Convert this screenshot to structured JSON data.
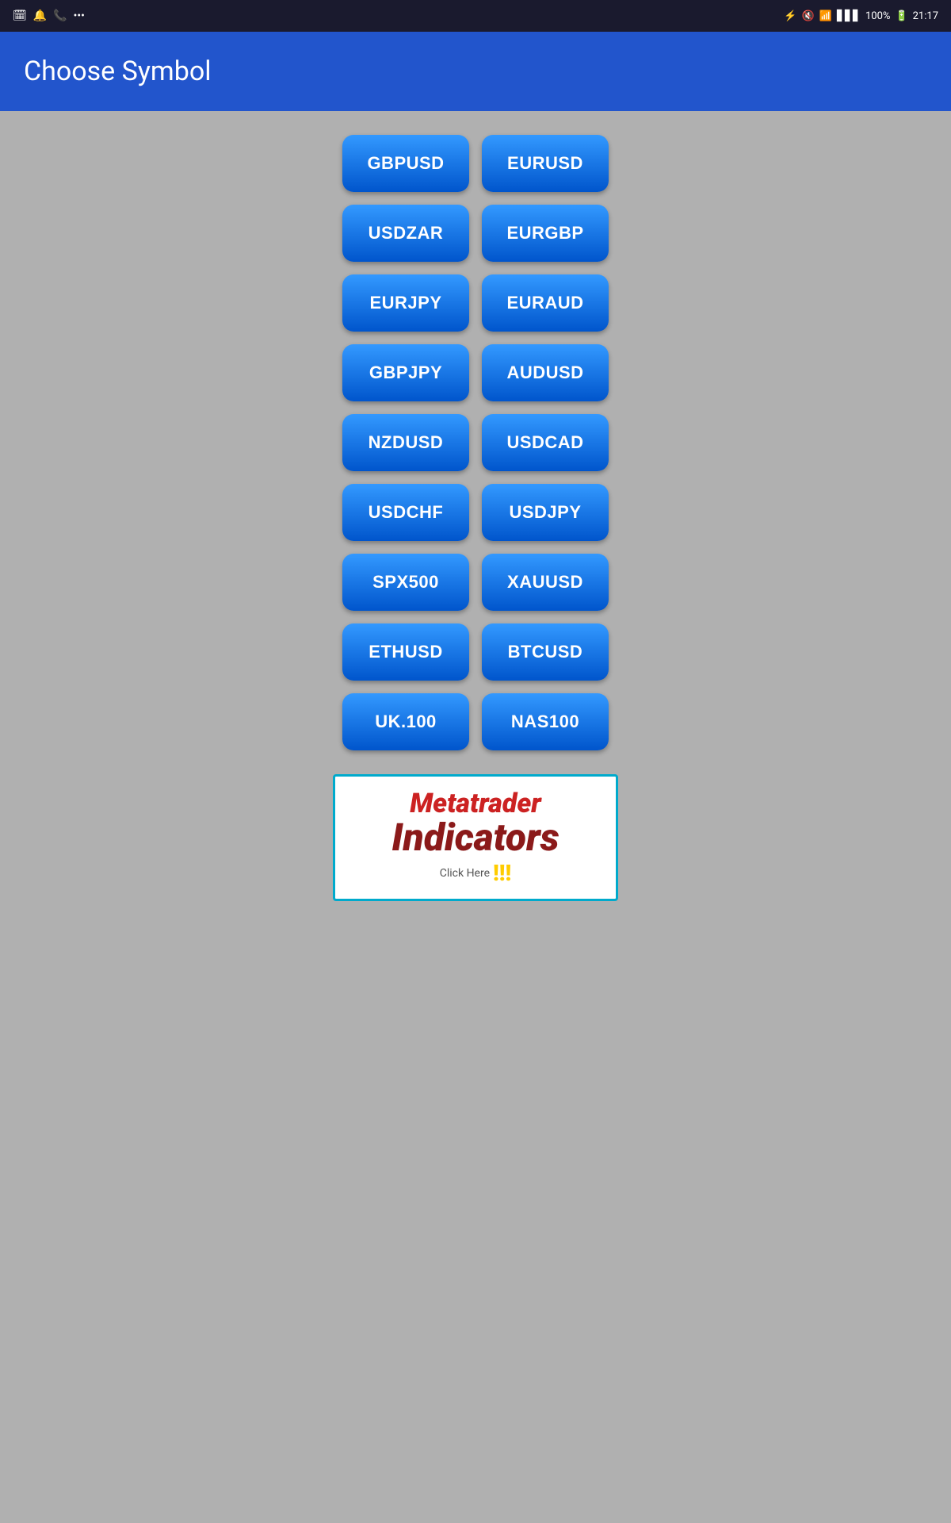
{
  "statusBar": {
    "leftIcons": [
      "bluetooth",
      "notification",
      "phone",
      "more"
    ],
    "rightIcons": [
      "bluetooth",
      "mute",
      "wifi",
      "signal"
    ],
    "battery": "100%",
    "time": "21:17"
  },
  "header": {
    "title": "Choose Symbol"
  },
  "symbols": [
    "GBPUSD",
    "EURUSD",
    "USDZAR",
    "EURGBP",
    "EURJPY",
    "EURAUD",
    "GBPJPY",
    "AUDUSD",
    "NZDUSD",
    "USDCAD",
    "USDCHF",
    "USDJPY",
    "SPX500",
    "XAUUSD",
    "ETHUSD",
    "BTCUSD",
    "UK.100",
    "NAS100"
  ],
  "adBanner": {
    "line1": "Metatrader",
    "line2": "Indicators",
    "clickText": "Click Here",
    "exclamations": "!!!"
  }
}
